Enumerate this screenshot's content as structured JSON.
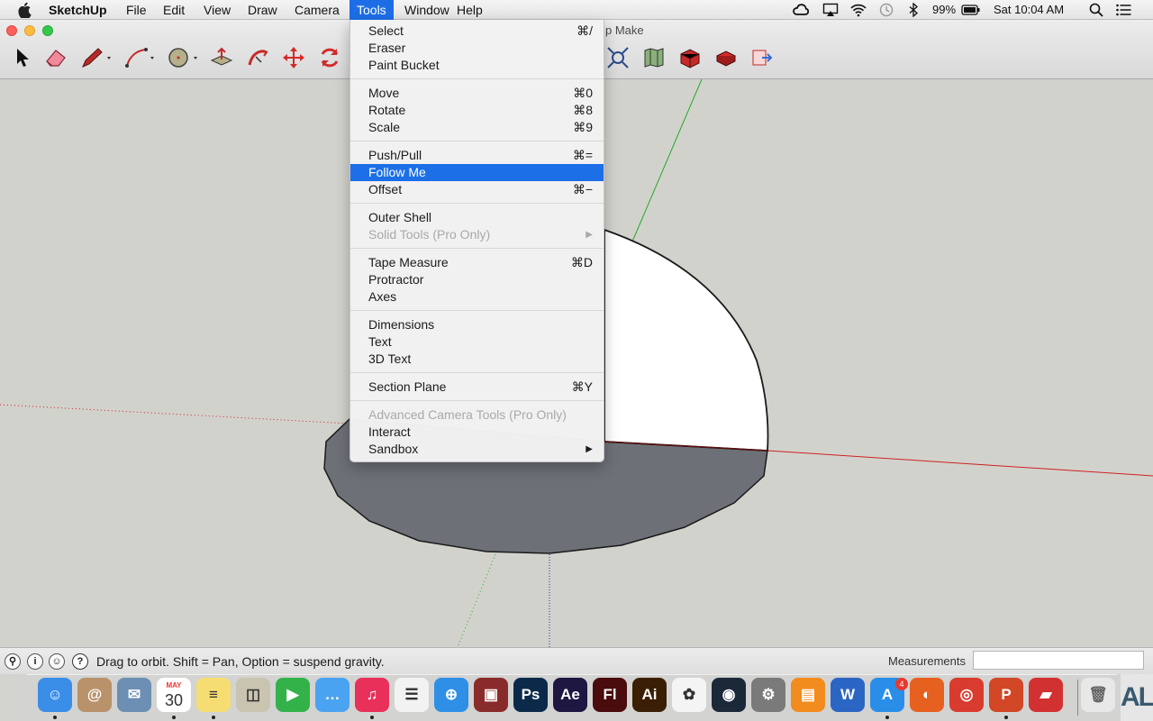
{
  "menubar": {
    "app_name": "SketchUp",
    "menus": [
      "File",
      "Edit",
      "View",
      "Draw",
      "Camera",
      "Tools",
      "Window",
      "Help"
    ],
    "active_menu": "Tools",
    "battery": "99%",
    "clock": "Sat 10:04 AM",
    "status_icons": [
      "creative-cloud-icon",
      "airplay-icon",
      "wifi-icon",
      "time-machine-icon",
      "bluetooth-icon",
      "battery-icon",
      "spotlight-icon",
      "notification-center-icon"
    ]
  },
  "window": {
    "title_fragment": "p Make"
  },
  "toolbar": {
    "tools": [
      "select-tool-icon",
      "eraser-tool-icon",
      "pencil-tool-icon",
      "arc-tool-icon",
      "circle-tool-icon",
      "push-pull-tool-icon",
      "follow-me-tool-icon",
      "move-tool-icon",
      "rotate-tool-icon",
      "zoom-extents-tool-icon",
      "map-tool-icon",
      "warehouse-tool-icon",
      "extension-warehouse-tool-icon",
      "send-to-layout-tool-icon"
    ]
  },
  "tools_menu": {
    "groups": [
      [
        {
          "label": "Select",
          "shortcut": "⌘/"
        },
        {
          "label": "Eraser",
          "shortcut": ""
        },
        {
          "label": "Paint Bucket",
          "shortcut": ""
        }
      ],
      [
        {
          "label": "Move",
          "shortcut": "⌘0"
        },
        {
          "label": "Rotate",
          "shortcut": "⌘8"
        },
        {
          "label": "Scale",
          "shortcut": "⌘9"
        }
      ],
      [
        {
          "label": "Push/Pull",
          "shortcut": "⌘="
        },
        {
          "label": "Follow Me",
          "shortcut": "",
          "highlighted": true
        },
        {
          "label": "Offset",
          "shortcut": "⌘−"
        }
      ],
      [
        {
          "label": "Outer Shell",
          "shortcut": ""
        },
        {
          "label": "Solid Tools (Pro Only)",
          "shortcut": "",
          "disabled": true,
          "submenu": true
        }
      ],
      [
        {
          "label": "Tape Measure",
          "shortcut": "⌘D"
        },
        {
          "label": "Protractor",
          "shortcut": ""
        },
        {
          "label": "Axes",
          "shortcut": ""
        }
      ],
      [
        {
          "label": "Dimensions",
          "shortcut": ""
        },
        {
          "label": "Text",
          "shortcut": ""
        },
        {
          "label": "3D Text",
          "shortcut": ""
        }
      ],
      [
        {
          "label": "Section Plane",
          "shortcut": "⌘Y"
        }
      ],
      [
        {
          "label": "Advanced Camera Tools (Pro Only)",
          "shortcut": "",
          "disabled": true
        },
        {
          "label": "Interact",
          "shortcut": ""
        },
        {
          "label": "Sandbox",
          "shortcut": "",
          "submenu": true
        }
      ]
    ]
  },
  "statusbar": {
    "hint": "Drag to orbit. Shift = Pan, Option = suspend gravity.",
    "measurements_label": "Measurements",
    "measurements_value": ""
  },
  "dock": {
    "calendar_month": "MAY",
    "calendar_day": "30",
    "app_store_badge": "4",
    "apps": [
      {
        "name": "finder-icon",
        "glyph": "☺",
        "color": "#3a8ee8"
      },
      {
        "name": "contacts-icon",
        "glyph": "@",
        "color": "#b8926a"
      },
      {
        "name": "preview-icon",
        "glyph": "✉",
        "color": "#6c8fb3"
      },
      {
        "name": "calendar-icon",
        "glyph": "",
        "color": "#ffffff"
      },
      {
        "name": "notes-icon",
        "glyph": "≡",
        "color": "#f5dd72"
      },
      {
        "name": "photo-booth-icon",
        "glyph": "◫",
        "color": "#c9c4b0"
      },
      {
        "name": "facetime-icon",
        "glyph": "▶",
        "color": "#34b24a"
      },
      {
        "name": "messages-icon",
        "glyph": "…",
        "color": "#4aa3f0"
      },
      {
        "name": "itunes-icon",
        "glyph": "♫",
        "color": "#e8305a"
      },
      {
        "name": "reminders-icon",
        "glyph": "☰",
        "color": "#f2f2f2"
      },
      {
        "name": "safari-icon",
        "glyph": "⊕",
        "color": "#2f8fe6"
      },
      {
        "name": "photo-app-icon",
        "glyph": "▣",
        "color": "#8a2b2b"
      },
      {
        "name": "photoshop-icon",
        "glyph": "Ps",
        "color": "#0b2a4a"
      },
      {
        "name": "after-effects-icon",
        "glyph": "Ae",
        "color": "#1d1741"
      },
      {
        "name": "flash-icon",
        "glyph": "Fl",
        "color": "#4a0c0c"
      },
      {
        "name": "illustrator-icon",
        "glyph": "Ai",
        "color": "#3b1f04"
      },
      {
        "name": "photos-icon",
        "glyph": "✿",
        "color": "#f4f4f4"
      },
      {
        "name": "steam-icon",
        "glyph": "◉",
        "color": "#1b2838"
      },
      {
        "name": "system-preferences-icon",
        "glyph": "⚙",
        "color": "#7a7a7a"
      },
      {
        "name": "ibooks-icon",
        "glyph": "▤",
        "color": "#f28c1e"
      },
      {
        "name": "word-icon",
        "glyph": "W",
        "color": "#2b66c4"
      },
      {
        "name": "app-store-icon",
        "glyph": "A",
        "color": "#2a8ee8"
      },
      {
        "name": "firefox-icon",
        "glyph": "◐",
        "color": "#e66020"
      },
      {
        "name": "chrome-icon",
        "glyph": "◎",
        "color": "#d93b2f"
      },
      {
        "name": "powerpoint-icon",
        "glyph": "P",
        "color": "#d24726"
      },
      {
        "name": "sketchup-icon",
        "glyph": "▰",
        "color": "#d23131"
      }
    ],
    "trash_icon": "trash-icon",
    "corner_text": "AL"
  },
  "colors": {
    "menu_highlight": "#1c6fe6",
    "canvas_bg": "#d2d2cd",
    "face_dark": "#6d7177",
    "axis_red": "#cc2222",
    "axis_green": "#22aa22",
    "axis_blue": "#2222cc"
  }
}
